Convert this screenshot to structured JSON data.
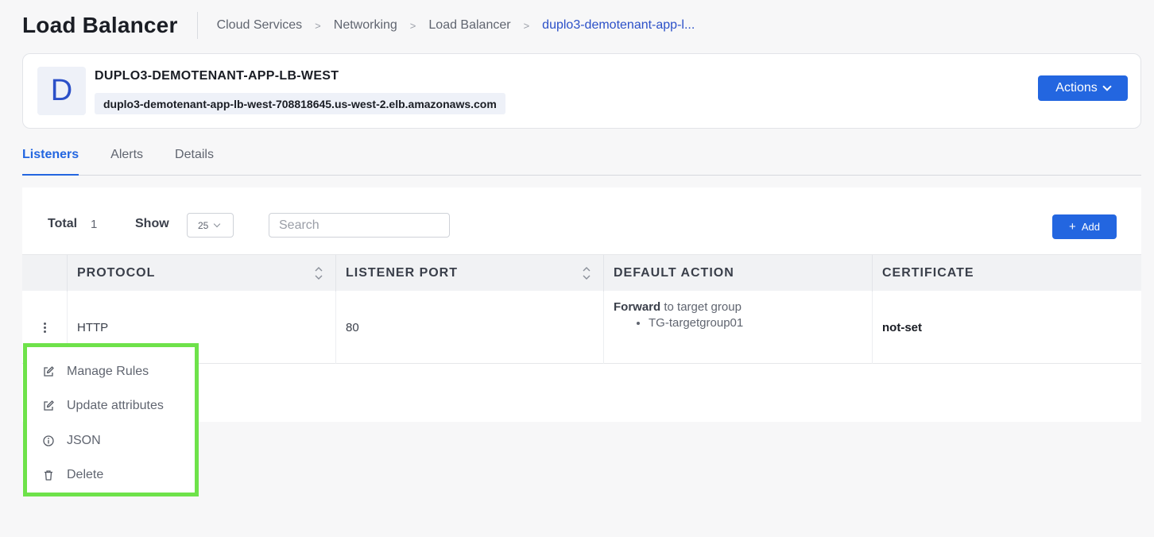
{
  "header": {
    "title": "Load Balancer",
    "breadcrumb": [
      "Cloud Services",
      "Networking",
      "Load Balancer",
      "duplo3-demotenant-app-l..."
    ]
  },
  "summary": {
    "avatar_letter": "D",
    "name": "DUPLO3-DEMOTENANT-APP-LB-WEST",
    "dns": "duplo3-demotenant-app-lb-west-708818645.us-west-2.elb.amazonaws.com",
    "actions_label": "Actions"
  },
  "tabs": [
    {
      "label": "Listeners",
      "active": true
    },
    {
      "label": "Alerts",
      "active": false
    },
    {
      "label": "Details",
      "active": false
    }
  ],
  "toolbar": {
    "total_label": "Total",
    "total_value": "1",
    "show_label": "Show",
    "show_value": "25",
    "search_placeholder": "Search",
    "add_label": "Add"
  },
  "table": {
    "columns": [
      "PROTOCOL",
      "LISTENER PORT",
      "DEFAULT ACTION",
      "CERTIFICATE"
    ],
    "rows": [
      {
        "protocol": "HTTP",
        "port": "80",
        "action_verb": "Forward",
        "action_rest": " to target group",
        "target_group": "TG-targetgroup01",
        "certificate": "not-set"
      }
    ]
  },
  "context_menu": {
    "items": [
      {
        "label": "Manage Rules",
        "icon": "edit-icon"
      },
      {
        "label": "Update attributes",
        "icon": "edit-icon"
      },
      {
        "label": "JSON",
        "icon": "info-icon"
      },
      {
        "label": "Delete",
        "icon": "trash-icon"
      }
    ],
    "highlight_color": "#6ee24a"
  },
  "colors": {
    "primary": "#2366e0",
    "breadcrumb_active": "#2b50c8"
  }
}
